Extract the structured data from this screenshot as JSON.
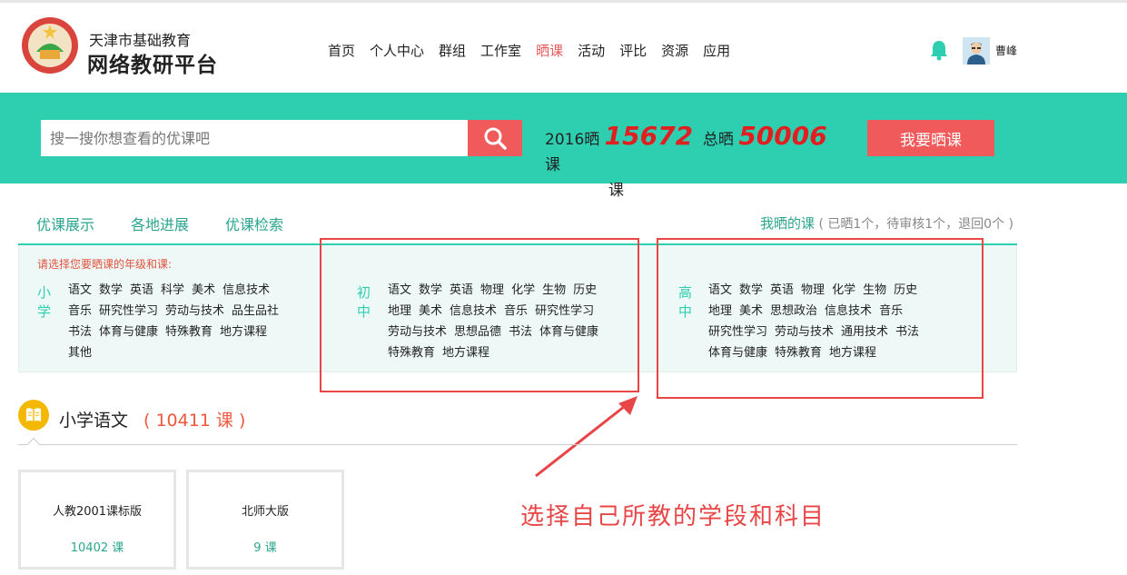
{
  "brand": {
    "line1": "天津市基础教育",
    "line2": "网络教研平台"
  },
  "nav": {
    "items": [
      {
        "label": "首页",
        "active": false
      },
      {
        "label": "个人中心",
        "active": false
      },
      {
        "label": "群组",
        "active": false
      },
      {
        "label": "工作室",
        "active": false
      },
      {
        "label": "晒课",
        "active": true
      },
      {
        "label": "活动",
        "active": false
      },
      {
        "label": "评比",
        "active": false
      },
      {
        "label": "资源",
        "active": false
      },
      {
        "label": "应用",
        "active": false
      }
    ]
  },
  "user": {
    "name": "曹峰"
  },
  "banner": {
    "search_placeholder": "搜一搜你想查看的优课吧",
    "stat_year_prefix": "2016晒",
    "stat_year_num": "15672",
    "stat_total_prefix": "总晒",
    "stat_total_num": "50006",
    "stat_unit": "课",
    "stat_unit2": "课",
    "share_button": "我要晒课"
  },
  "tabs": {
    "items": [
      "优课展示",
      "各地进展",
      "优课检索"
    ],
    "my_link": "我晒的课",
    "my_status": "( 已晒1个，待审核1个，退回0个 )"
  },
  "picker": {
    "hint": "请选择您要晒课的年级和课:",
    "primary": {
      "label": "小学",
      "subjects": [
        "语文",
        "数学",
        "英语",
        "科学",
        "美术",
        "信息技术",
        "音乐",
        "研究性学习",
        "劳动与技术",
        "品生品社",
        "书法",
        "体育与健康",
        "特殊教育",
        "地方课程",
        "其他"
      ]
    },
    "middle": {
      "label": "初中",
      "subjects": [
        "语文",
        "数学",
        "英语",
        "物理",
        "化学",
        "生物",
        "历史",
        "地理",
        "美术",
        "信息技术",
        "音乐",
        "研究性学习",
        "劳动与技术",
        "思想品德",
        "书法",
        "体育与健康",
        "特殊教育",
        "地方课程"
      ]
    },
    "high": {
      "label": "高中",
      "subjects": [
        "语文",
        "数学",
        "英语",
        "物理",
        "化学",
        "生物",
        "历史",
        "地理",
        "美术",
        "思想政治",
        "信息技术",
        "音乐",
        "研究性学习",
        "劳动与技术",
        "通用技术",
        "书法",
        "体育与健康",
        "特殊教育",
        "地方课程"
      ]
    }
  },
  "annotation": "选择自己所教的学段和科目",
  "section": {
    "title": "小学语文",
    "count": "( 10411 课 )"
  },
  "cards": [
    {
      "name": "人教2001课标版",
      "count": "10402 课"
    },
    {
      "name": "北师大版",
      "count": "9 课"
    }
  ],
  "colors": {
    "teal": "#2ecfb1",
    "red": "#f05a5a",
    "link": "#2ba58e"
  }
}
